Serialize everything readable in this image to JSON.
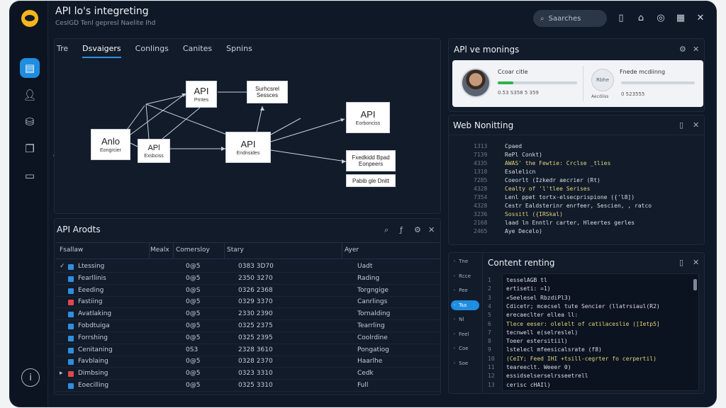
{
  "app": {
    "title": "API lo's integreting",
    "subtitle": "CesIGD Tenl gepresl Naelite Ihd"
  },
  "header": {
    "search_placeholder": "Saarches"
  },
  "tabs": [
    "Tre",
    "Dsvaigers",
    "Conlings",
    "Canites",
    "Spnins"
  ],
  "diagram": {
    "nodes": [
      {
        "title": "API",
        "sub": "Prntes"
      },
      {
        "title": "",
        "sub": "Surhcsrel Sessces"
      },
      {
        "title": "Anlo",
        "sub": "Eongrcier"
      },
      {
        "title": "APl",
        "sub": "Exsbciss"
      },
      {
        "title": "API",
        "sub": "Endnsides"
      },
      {
        "title": "API",
        "sub": "Eorbonciss"
      },
      {
        "title": "",
        "sub": "Fxedkidd Bpad Eonpeers"
      },
      {
        "title": "",
        "sub": "Pabib gle Dnitt"
      }
    ]
  },
  "monitor_panel": {
    "title": "APl ve monings",
    "user1": {
      "name": "Ccoar citle",
      "meta": "0.53 S358   5 359"
    },
    "user2": {
      "name": "Fnede mcdiinng",
      "meta": "0 523555",
      "label": "Aecdiiss",
      "avatar": "Rbhe"
    }
  },
  "web_panel": {
    "title": "Web Nonitting",
    "lines": [
      {
        "n": "1313",
        "t": "Cpaed"
      },
      {
        "n": "7139",
        "t": "RePl  Conkt)"
      },
      {
        "n": "4335",
        "t": "AWAS' the Fewtie: Crclse _tlies"
      },
      {
        "n": "1318",
        "t": "Esalelicn"
      },
      {
        "n": "7285",
        "t": "Coeorlt (Izkedr aecrier (Rt)"
      },
      {
        "n": "4328",
        "t": "Cealty of 'l'tlee Serises"
      },
      {
        "n": "7354",
        "t": "Lenl ppet  tortx-elsecprispione ({'l8])"
      },
      {
        "n": "4328",
        "t": "Cestr Ealdsterinr enrfeer, Sescien, , ratco"
      },
      {
        "n": "3236",
        "t": "Sossitl  ({IRSkal)"
      },
      {
        "n": "2168",
        "t": "laad ln Enntlr carter, Hleertes gerles"
      },
      {
        "n": "2465",
        "t": "Aye Decelo)"
      }
    ]
  },
  "content_panel": {
    "title": "Content renting",
    "nav": [
      "Tne",
      "Rcce",
      "Pee",
      "Tsa",
      "Nl",
      "Feel",
      "Coe",
      "Soe"
    ],
    "lines": [
      {
        "n": "1",
        "t": "tesselAGB tl"
      },
      {
        "n": "2",
        "t": "    ertiseti: =1)"
      },
      {
        "n": "3",
        "t": "      «Seelesel RbzdiPl3)"
      },
      {
        "n": "4",
        "t": "        Cdicetr; mcecsel tute Sencier (llatrsiaul(R2)"
      },
      {
        "n": "5",
        "t": "        erecaeclter ellea ll:"
      },
      {
        "n": "6",
        "t": "          Tlece eeser: olelelt of catilaceslie ([Ietp5]"
      },
      {
        "n": "7",
        "t": "          tecnwell  e(selreslel)"
      },
      {
        "n": "8",
        "t": "          Toeer estersitiil)"
      },
      {
        "n": "9",
        "t": "        lstelecl mfeesicalsrate (f8)"
      },
      {
        "n": "10",
        "t": "        (CeIY; Feed IHI +tsill-cegrter fo cerpertil)"
      },
      {
        "n": "11",
        "t": "        teareeclt. Weeer  0)"
      },
      {
        "n": "12",
        "t": "          essidselserselrsseetrell"
      },
      {
        "n": "13",
        "t": "          cerisc cHAIl)"
      }
    ]
  },
  "table": {
    "title": "API Arodts",
    "headers": [
      "Fsallaw",
      "Mealx",
      "Comersloy",
      "Stary",
      "Ayer"
    ],
    "rows": [
      {
        "name": "Ltessing",
        "mx": "",
        "c": "0@5",
        "s": "0383 3D70",
        "a": "Uadt",
        "color": "#2d8fe0"
      },
      {
        "name": "Fearllinis",
        "mx": "",
        "c": "0@5",
        "s": "2350 3270",
        "a": "Rading",
        "color": "#2d8fe0"
      },
      {
        "name": "Eeeding",
        "mx": "",
        "c": "0@S",
        "s": "0326 2368",
        "a": "Torgngige",
        "color": "#2d8fe0"
      },
      {
        "name": "Fastiing",
        "mx": "",
        "c": "0@5",
        "s": "0329 3370",
        "a": "Canrlings",
        "color": "#e0484a"
      },
      {
        "name": "Avatlaking",
        "mx": "",
        "c": "0@5",
        "s": "2330 2390",
        "a": "Tornalding",
        "color": "#2d8fe0"
      },
      {
        "name": "Fobdtuiga",
        "mx": "",
        "c": "0@5",
        "s": "0325 2375",
        "a": "Tearrling",
        "color": "#2d8fe0"
      },
      {
        "name": "Forrshing",
        "mx": "",
        "c": "0@5",
        "s": "0325 2395",
        "a": "Coolrdine",
        "color": "#2d8fe0"
      },
      {
        "name": "Cenitaning",
        "mx": "",
        "c": "0S3",
        "s": "2328 3610",
        "a": "Pongatiog",
        "color": "#2d8fe0"
      },
      {
        "name": "Favblaing",
        "mx": "",
        "c": "0@5",
        "s": "0328 2370",
        "a": "Haarlhe",
        "color": "#2d8fe0"
      },
      {
        "name": "Dimbsing",
        "mx": "",
        "c": "0@5",
        "s": "0323 3310",
        "a": "Cedk",
        "color": "#e0484a"
      },
      {
        "name": "Eoecilling",
        "mx": "",
        "c": "0@5",
        "s": "0325 3310",
        "a": "Full",
        "color": "#2d8fe0"
      }
    ]
  }
}
